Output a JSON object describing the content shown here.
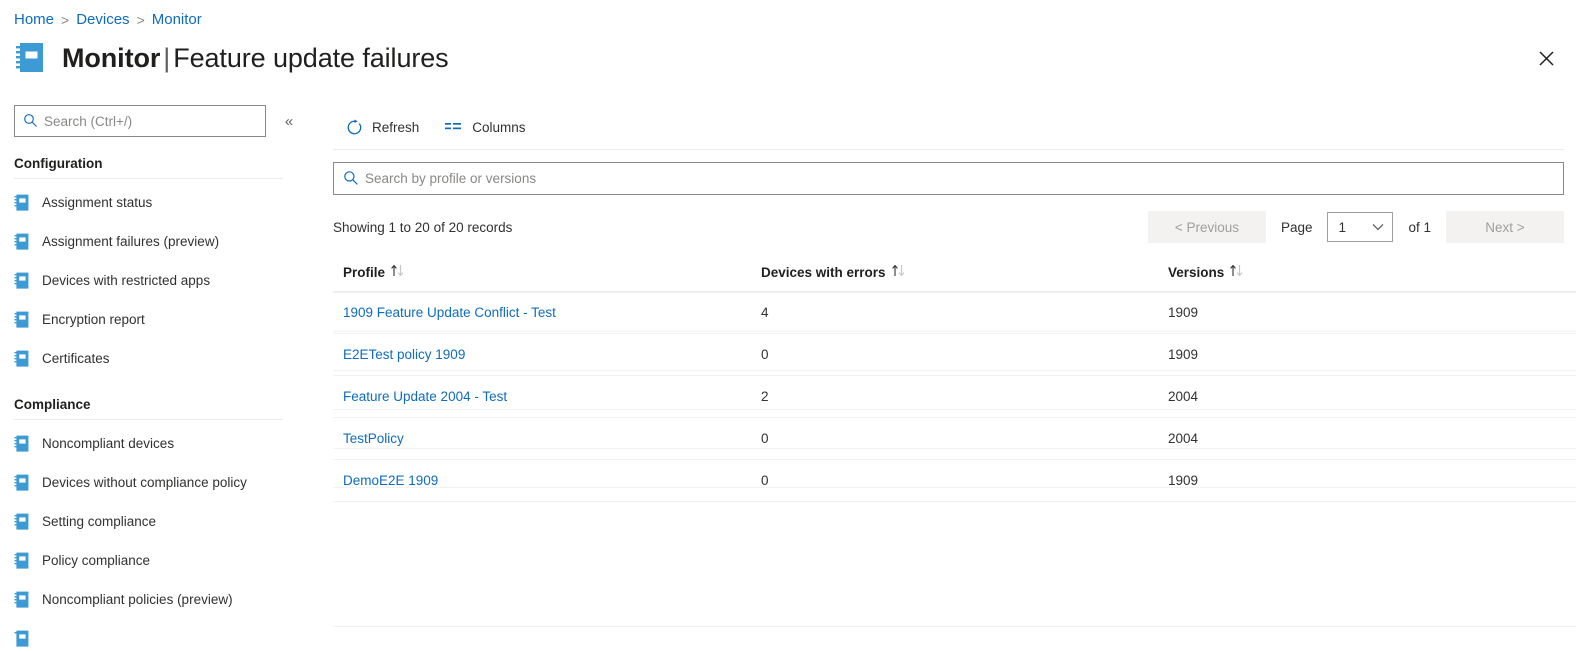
{
  "breadcrumb": {
    "items": [
      {
        "label": "Home"
      },
      {
        "label": "Devices"
      },
      {
        "label": "Monitor"
      }
    ],
    "separator": ">"
  },
  "header": {
    "title_bold": "Monitor",
    "title_separator": "|",
    "title_rest": "Feature update failures",
    "icon": "monitor-report-icon",
    "close_icon": "close-icon"
  },
  "sidebar": {
    "search": {
      "placeholder": "Search (Ctrl+/)",
      "value": "",
      "icon": "search-icon"
    },
    "collapse": {
      "icon": "double-chevron-left-icon",
      "label": "«"
    },
    "sections": [
      {
        "title": "Configuration",
        "items": [
          {
            "label": "Assignment status",
            "icon": "report-icon"
          },
          {
            "label": "Assignment failures (preview)",
            "icon": "report-icon"
          },
          {
            "label": "Devices with restricted apps",
            "icon": "report-icon"
          },
          {
            "label": "Encryption report",
            "icon": "report-icon"
          },
          {
            "label": "Certificates",
            "icon": "report-icon"
          }
        ]
      },
      {
        "title": "Compliance",
        "items": [
          {
            "label": "Noncompliant devices",
            "icon": "report-icon"
          },
          {
            "label": "Devices without compliance policy",
            "icon": "report-icon"
          },
          {
            "label": "Setting compliance",
            "icon": "report-icon"
          },
          {
            "label": "Policy compliance",
            "icon": "report-icon"
          },
          {
            "label": "Noncompliant policies (preview)",
            "icon": "report-icon"
          }
        ]
      }
    ]
  },
  "toolbar": {
    "refresh_label": "Refresh",
    "refresh_icon": "refresh-icon",
    "columns_label": "Columns",
    "columns_icon": "columns-icon"
  },
  "grid_search": {
    "placeholder": "Search by profile or versions",
    "value": "",
    "icon": "search-icon"
  },
  "pagination": {
    "record_summary": "Showing 1 to 20 of 20 records",
    "previous_label": "< Previous",
    "page_label": "Page",
    "page_value": "1",
    "page_options": [
      "1"
    ],
    "of_label": "of 1",
    "next_label": "Next >",
    "chevron_icon": "chevron-down-icon"
  },
  "table": {
    "sort_icon": "sort-ascending-descending-icon",
    "columns": [
      {
        "label": "Profile",
        "sortable": true
      },
      {
        "label": "Devices with errors",
        "sortable": true
      },
      {
        "label": "Versions",
        "sortable": true
      }
    ],
    "rows": [
      {
        "profile": "1909 Feature Update Conflict - Test",
        "devices_with_errors": "4",
        "versions": "1909"
      },
      {
        "profile": "E2ETest policy 1909",
        "devices_with_errors": "0",
        "versions": "1909"
      },
      {
        "profile": "Feature Update 2004 - Test",
        "devices_with_errors": "2",
        "versions": "2004"
      },
      {
        "profile": "TestPolicy",
        "devices_with_errors": "0",
        "versions": "2004"
      },
      {
        "profile": "DemoE2E 1909",
        "devices_with_errors": "0",
        "versions": "1909"
      }
    ]
  },
  "colors": {
    "link_blue": "#0f6cbd",
    "icon_blue": "#3c9ad4",
    "text_primary": "#323130",
    "text_heading": "#201f1e",
    "border": "#edebe9",
    "row_border": "#f3f2f1",
    "disabled_bg": "#f3f2f1",
    "disabled_text": "#a19f9d"
  }
}
